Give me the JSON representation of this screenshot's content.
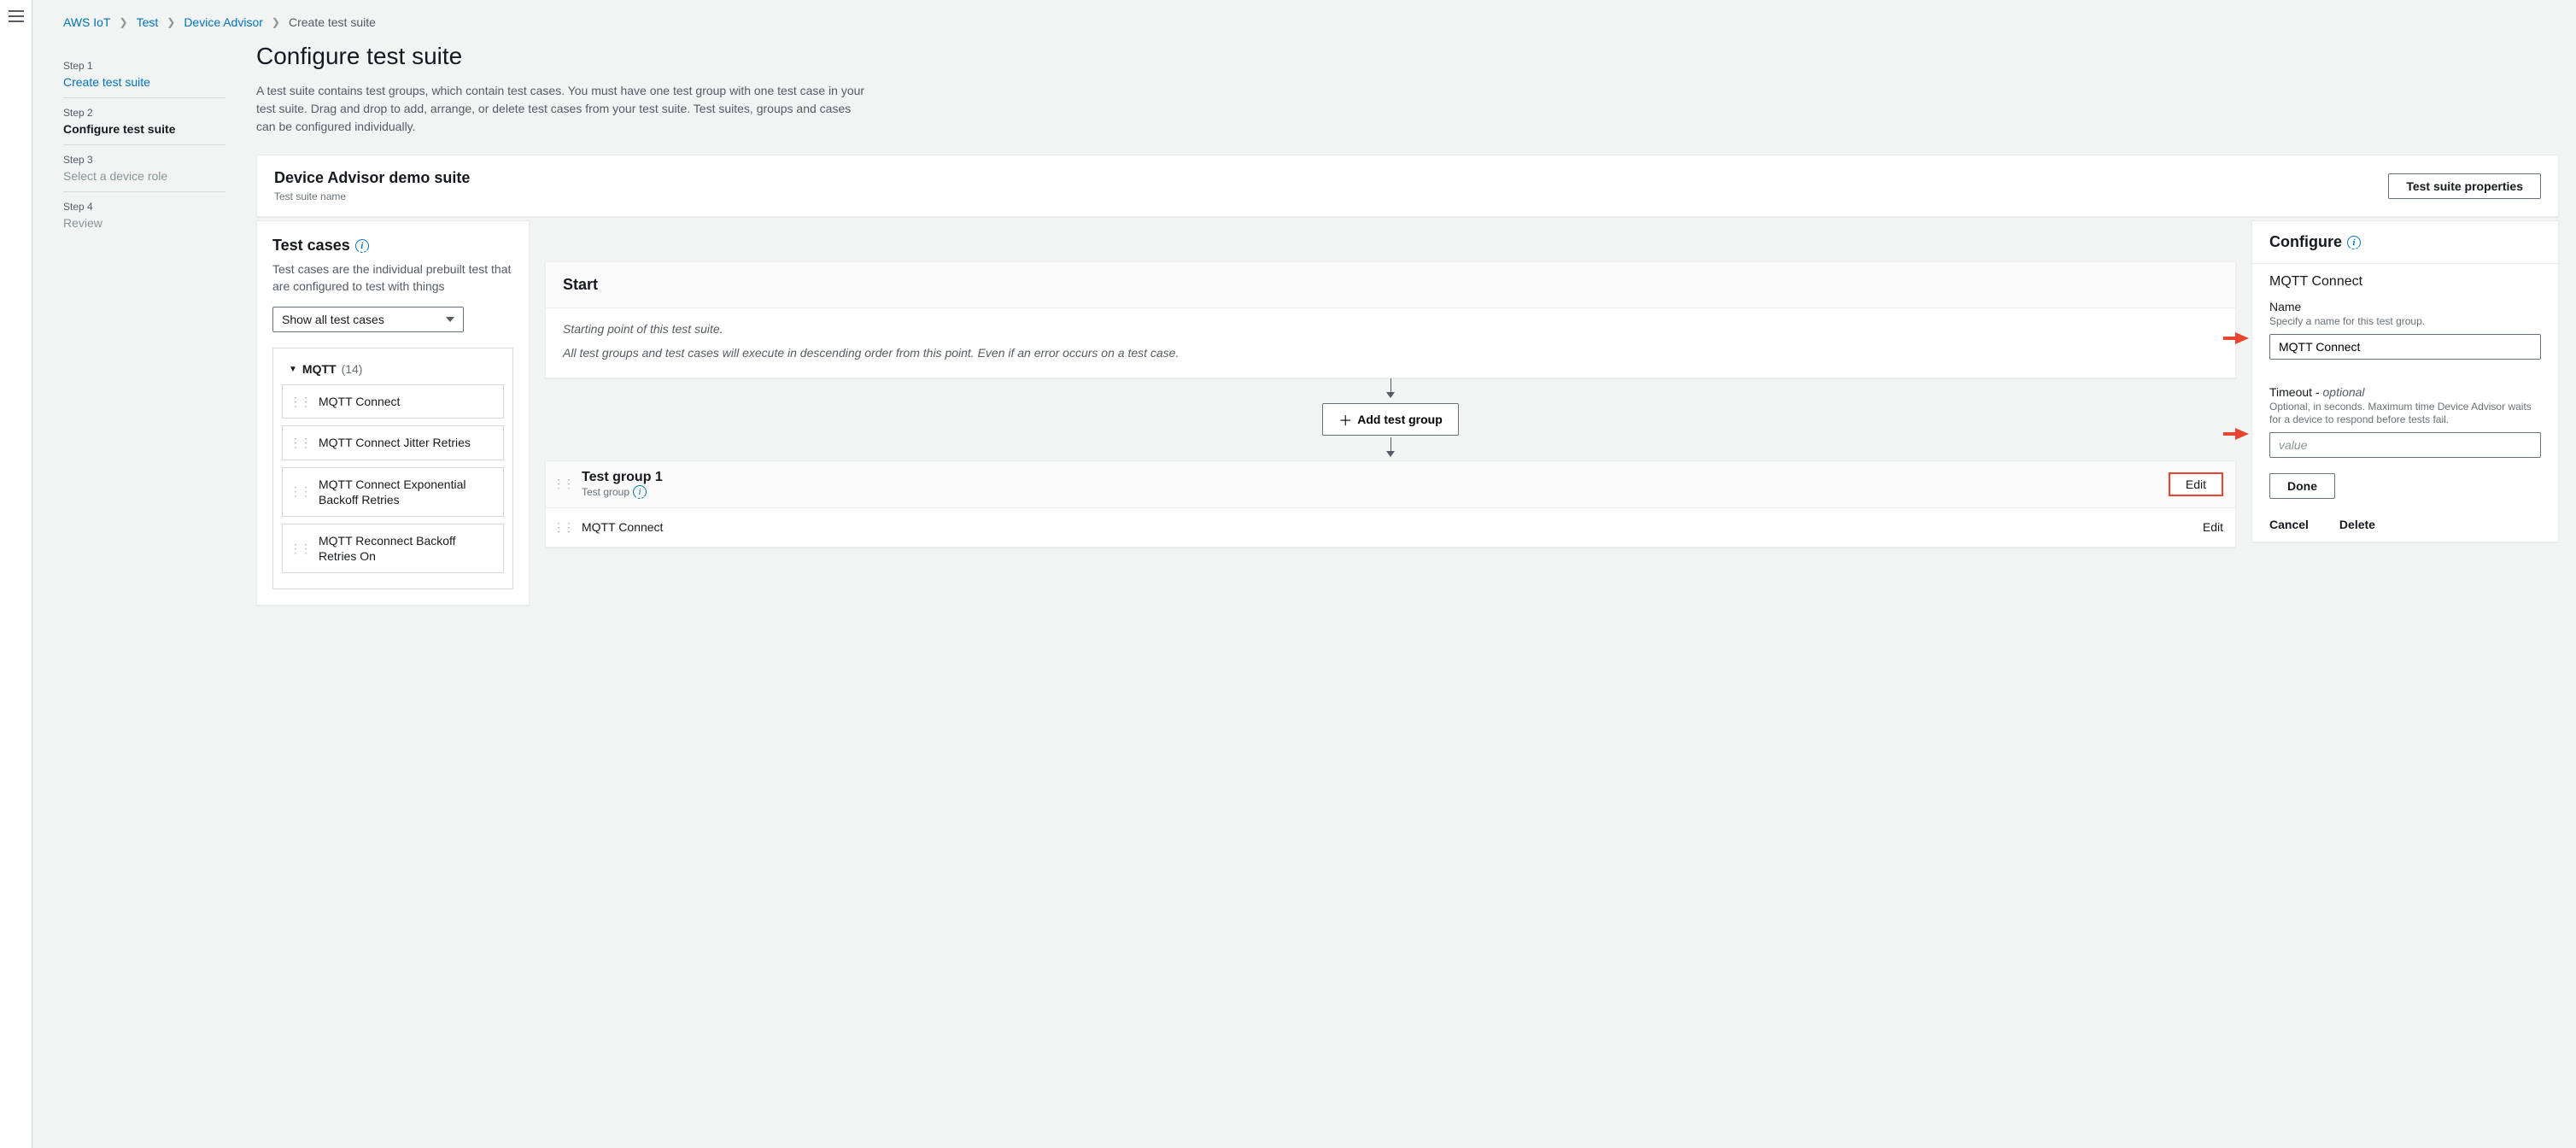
{
  "breadcrumbs": {
    "items": [
      "AWS IoT",
      "Test",
      "Device Advisor"
    ],
    "current": "Create test suite"
  },
  "wizard": {
    "step1": {
      "num": "Step 1",
      "title": "Create test suite"
    },
    "step2": {
      "num": "Step 2",
      "title": "Configure test suite"
    },
    "step3": {
      "num": "Step 3",
      "title": "Select a device role"
    },
    "step4": {
      "num": "Step 4",
      "title": "Review"
    }
  },
  "page": {
    "title": "Configure test suite",
    "desc": "A test suite contains test groups, which contain test cases. You must have one test group with one test case in your test suite. Drag and drop to add, arrange, or delete test cases from your test suite. Test suites, groups and cases can be configured individually."
  },
  "suite_header": {
    "name": "Device Advisor demo suite",
    "sub": "Test suite name",
    "properties_btn": "Test suite properties"
  },
  "testcases_panel": {
    "title": "Test cases",
    "desc": "Test cases are the individual prebuilt test that are configured to test with things",
    "filter": "Show all test cases",
    "tree": {
      "name": "MQTT",
      "count": "(14)",
      "items": [
        "MQTT Connect",
        "MQTT Connect Jitter Retries",
        "MQTT Connect Exponential Backoff Retries",
        "MQTT Reconnect Backoff Retries On"
      ]
    }
  },
  "start_panel": {
    "title": "Start",
    "line1": "Starting point of this test suite.",
    "line2": "All test groups and test cases will execute in descending order from this point. Even if an error occurs on a test case."
  },
  "add_group_btn": "Add test group",
  "test_group": {
    "title": "Test group 1",
    "sub": "Test group",
    "edit": "Edit",
    "row1": {
      "name": "MQTT Connect",
      "edit": "Edit"
    }
  },
  "configure_panel": {
    "title": "Configure",
    "subtitle": "MQTT Connect",
    "name_field": {
      "label": "Name",
      "help": "Specify a name for this test group.",
      "value": "MQTT Connect"
    },
    "timeout_field": {
      "label": "Timeout - ",
      "optional": "optional",
      "help": "Optional, in seconds. Maximum time Device Advisor waits for a device to respond before tests fail.",
      "placeholder": "value"
    },
    "done": "Done",
    "cancel": "Cancel",
    "delete": "Delete"
  }
}
